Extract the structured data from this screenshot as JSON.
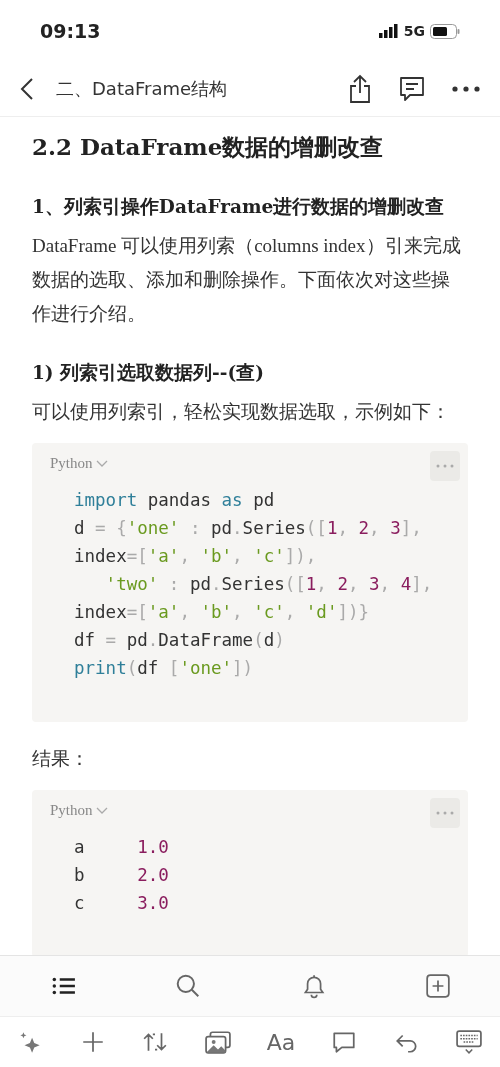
{
  "status_bar": {
    "time": "09:13",
    "network": "5G"
  },
  "nav": {
    "title": "二、DataFrame结构"
  },
  "blocks": [
    {
      "kind": "h2",
      "text": "2.2 DataFrame数据的增删改查"
    },
    {
      "kind": "h3",
      "text": "1、列索引操作DataFrame进行数据的增删改查"
    },
    {
      "kind": "p",
      "text": "DataFrame 可以使用列索（columns index）引来完成数据的选取、添加和删除操作。下面依次对这些操作进行介绍。"
    },
    {
      "kind": "h3",
      "text": "1) 列索引选取数据列--(查)"
    },
    {
      "kind": "p",
      "text": "可以使用列索引，轻松实现数据选取，示例如下："
    },
    {
      "kind": "code",
      "language": "Python",
      "lines": [
        [
          {
            "kind": "k",
            "t": "import"
          },
          {
            "kind": "p",
            "t": " pandas "
          },
          {
            "kind": "k",
            "t": "as"
          },
          {
            "kind": "p",
            "t": " pd"
          }
        ],
        [
          {
            "kind": "p",
            "t": "d "
          },
          {
            "kind": "g",
            "t": "= {"
          },
          {
            "kind": "s",
            "t": "'one'"
          },
          {
            "kind": "g",
            "t": " : "
          },
          {
            "kind": "p",
            "t": "pd"
          },
          {
            "kind": "g",
            "t": "."
          },
          {
            "kind": "p",
            "t": "Series"
          },
          {
            "kind": "g",
            "t": "(["
          },
          {
            "kind": "n",
            "t": "1"
          },
          {
            "kind": "g",
            "t": ", "
          },
          {
            "kind": "n",
            "t": "2"
          },
          {
            "kind": "g",
            "t": ", "
          },
          {
            "kind": "n",
            "t": "3"
          },
          {
            "kind": "g",
            "t": "],"
          }
        ],
        [
          {
            "kind": "p",
            "t": "index"
          },
          {
            "kind": "g",
            "t": "=["
          },
          {
            "kind": "s",
            "t": "'a'"
          },
          {
            "kind": "g",
            "t": ", "
          },
          {
            "kind": "s",
            "t": "'b'"
          },
          {
            "kind": "g",
            "t": ", "
          },
          {
            "kind": "s",
            "t": "'c'"
          },
          {
            "kind": "g",
            "t": "]),"
          }
        ],
        [
          {
            "kind": "indent"
          },
          {
            "kind": "s",
            "t": "'two'"
          },
          {
            "kind": "g",
            "t": " : "
          },
          {
            "kind": "p",
            "t": "pd"
          },
          {
            "kind": "g",
            "t": "."
          },
          {
            "kind": "p",
            "t": "Series"
          },
          {
            "kind": "g",
            "t": "(["
          },
          {
            "kind": "n",
            "t": "1"
          },
          {
            "kind": "g",
            "t": ", "
          },
          {
            "kind": "n",
            "t": "2"
          },
          {
            "kind": "g",
            "t": ", "
          },
          {
            "kind": "n",
            "t": "3"
          },
          {
            "kind": "g",
            "t": ", "
          },
          {
            "kind": "n",
            "t": "4"
          },
          {
            "kind": "g",
            "t": "],"
          }
        ],
        [
          {
            "kind": "p",
            "t": "index"
          },
          {
            "kind": "g",
            "t": "=["
          },
          {
            "kind": "s",
            "t": "'a'"
          },
          {
            "kind": "g",
            "t": ", "
          },
          {
            "kind": "s",
            "t": "'b'"
          },
          {
            "kind": "g",
            "t": ", "
          },
          {
            "kind": "s",
            "t": "'c'"
          },
          {
            "kind": "g",
            "t": ", "
          },
          {
            "kind": "s",
            "t": "'d'"
          },
          {
            "kind": "g",
            "t": "])}"
          }
        ],
        [
          {
            "kind": "p",
            "t": "df "
          },
          {
            "kind": "g",
            "t": "= "
          },
          {
            "kind": "p",
            "t": "pd"
          },
          {
            "kind": "g",
            "t": "."
          },
          {
            "kind": "p",
            "t": "DataFrame"
          },
          {
            "kind": "g",
            "t": "("
          },
          {
            "kind": "p",
            "t": "d"
          },
          {
            "kind": "g",
            "t": ")"
          }
        ],
        [
          {
            "kind": "k",
            "t": "print"
          },
          {
            "kind": "g",
            "t": "("
          },
          {
            "kind": "p",
            "t": "df "
          },
          {
            "kind": "g",
            "t": "["
          },
          {
            "kind": "s",
            "t": "'one'"
          },
          {
            "kind": "g",
            "t": "])"
          }
        ]
      ]
    },
    {
      "kind": "p",
      "text": "结果："
    },
    {
      "kind": "code",
      "language": "Python",
      "lines": [
        [
          {
            "kind": "p",
            "t": "a     "
          },
          {
            "kind": "n",
            "t": "1.0"
          }
        ],
        [
          {
            "kind": "p",
            "t": "b     "
          },
          {
            "kind": "n",
            "t": "2.0"
          }
        ],
        [
          {
            "kind": "p",
            "t": "c     "
          },
          {
            "kind": "n",
            "t": "3.0"
          }
        ]
      ]
    }
  ],
  "editor_bar": {
    "text_style": "Aa"
  }
}
